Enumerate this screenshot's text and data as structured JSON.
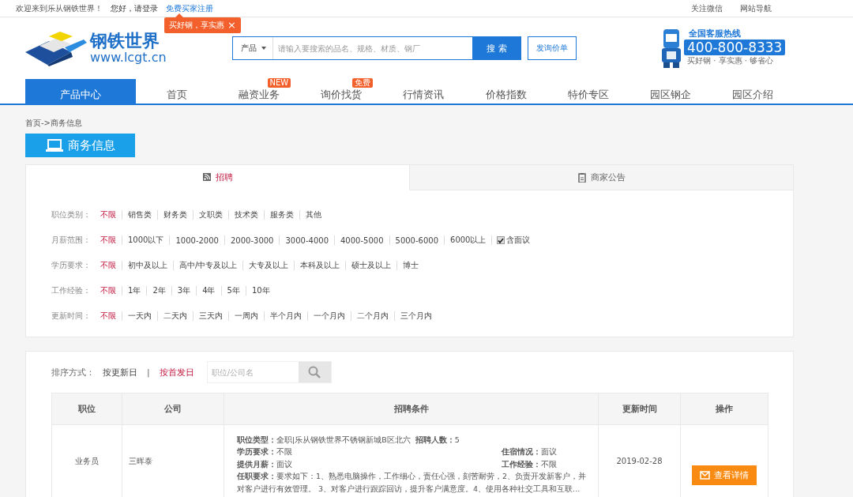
{
  "top_bar": {
    "welcome": "欢迎来到乐从钢铁世界！",
    "login_prompt": "您好，请登录",
    "register_link": "免费买家注册",
    "links": [
      "关注微信",
      "网站导航"
    ]
  },
  "promo_tip": {
    "text": "买好钢，享实惠",
    "close": "×"
  },
  "logo": {
    "name": "钢铁世界",
    "url": "www.lcgt.cn"
  },
  "search": {
    "category": "产品",
    "placeholder": "请输入要搜索的品名、规格、材质、钢厂",
    "button": "搜 索"
  },
  "inquiry_button": "发询价单",
  "hotline": {
    "title": "全国客服热线",
    "number": "400-800-8333",
    "slogan": "买好钢 · 享实惠 · 够省心"
  },
  "nav": [
    {
      "label": "产品中心",
      "selected": true
    },
    {
      "label": "首页",
      "selected": false
    },
    {
      "label": "融资业务",
      "selected": false,
      "badge": "NEW"
    },
    {
      "label": "询价找货",
      "selected": false,
      "badge": "免费"
    },
    {
      "label": "行情资讯",
      "selected": false
    },
    {
      "label": "价格指数",
      "selected": false
    },
    {
      "label": "特价专区",
      "selected": false
    },
    {
      "label": "园区钢企",
      "selected": false
    },
    {
      "label": "园区介绍",
      "selected": false
    }
  ],
  "breadcrumb": "首页->商务信息",
  "section_title": "商务信息",
  "tabs": [
    {
      "label": "招聘",
      "selected": true,
      "kind": "feed"
    },
    {
      "label": "商家公告",
      "selected": false,
      "kind": "notice"
    }
  ],
  "filters": [
    {
      "label": "职位类别：",
      "options": [
        {
          "text": "不限",
          "selected": true
        },
        {
          "text": "销售类",
          "selected": false
        },
        {
          "text": "财务类",
          "selected": false
        },
        {
          "text": "文职类",
          "selected": false
        },
        {
          "text": "技术类",
          "selected": false
        },
        {
          "text": "服务类",
          "selected": false
        },
        {
          "text": "其他",
          "selected": false
        }
      ]
    },
    {
      "label": "月薪范围：",
      "options": [
        {
          "text": "不限",
          "selected": true
        },
        {
          "text": "1000以下",
          "selected": false
        },
        {
          "text": "1000-2000",
          "selected": false
        },
        {
          "text": "2000-3000",
          "selected": false
        },
        {
          "text": "3000-4000",
          "selected": false
        },
        {
          "text": "4000-5000",
          "selected": false
        },
        {
          "text": "5000-6000",
          "selected": false
        },
        {
          "text": "6000以上",
          "selected": false
        }
      ],
      "checkbox": {
        "label": "含面议",
        "checked": true
      }
    },
    {
      "label": "学历要求：",
      "options": [
        {
          "text": "不限",
          "selected": true
        },
        {
          "text": "初中及以上",
          "selected": false
        },
        {
          "text": "高中/中专及以上",
          "selected": false
        },
        {
          "text": "大专及以上",
          "selected": false
        },
        {
          "text": "本科及以上",
          "selected": false
        },
        {
          "text": "硕士及以上",
          "selected": false
        },
        {
          "text": "博士",
          "selected": false
        }
      ]
    },
    {
      "label": "工作经验：",
      "options": [
        {
          "text": "不限",
          "selected": true
        },
        {
          "text": "1年",
          "selected": false
        },
        {
          "text": "2年",
          "selected": false
        },
        {
          "text": "3年",
          "selected": false
        },
        {
          "text": "4年",
          "selected": false
        },
        {
          "text": "5年",
          "selected": false
        },
        {
          "text": "10年",
          "selected": false
        }
      ]
    },
    {
      "label": "更新时间：",
      "options": [
        {
          "text": "不限",
          "selected": true
        },
        {
          "text": "一天内",
          "selected": false
        },
        {
          "text": "二天内",
          "selected": false
        },
        {
          "text": "三天内",
          "selected": false
        },
        {
          "text": "一周内",
          "selected": false
        },
        {
          "text": "半个月内",
          "selected": false
        },
        {
          "text": "一个月内",
          "selected": false
        },
        {
          "text": "二个月内",
          "selected": false
        },
        {
          "text": "三个月内",
          "selected": false
        }
      ]
    }
  ],
  "sort": {
    "label": "排序方式：",
    "options": [
      {
        "text": "按更新日",
        "selected": false
      },
      {
        "text": "按首发日",
        "selected": true
      }
    ],
    "separator": "|",
    "search_placeholder": "职位/公司名"
  },
  "table": {
    "columns": [
      "职位",
      "公司",
      "招聘条件",
      "更新时间",
      "操作"
    ],
    "rows": [
      {
        "position": "业务员",
        "company": "三晖泰",
        "conditions": [
          [
            "**职位类型：**全职|乐从钢铁世界不锈钢新城B区北六",
            "**招聘人数：**5"
          ],
          [
            "**学历要求：**不限",
            "**住宿情况：**面议"
          ],
          [
            "**提供月薪：**面议",
            "**工作经验：**不限"
          ]
        ],
        "requirements": "**任职要求：**要求如下：1、熟悉电脑操作，工作细心，责任心强，刻苦耐劳，2、负责开发新客户，并对客户进行有效管理。 3、对客户进行跟踪回访，提升客户满意度。4、使用各种社交工具和互联...",
        "date": "2019-02-28",
        "action": "查看详情"
      }
    ]
  }
}
